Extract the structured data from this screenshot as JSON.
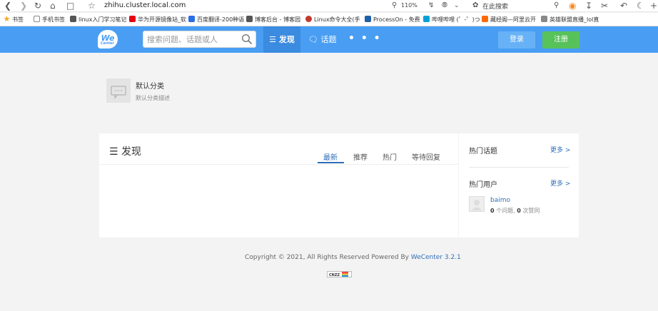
{
  "browser": {
    "url": "zhihu.cluster.local.com",
    "zoom": "110%",
    "search_placeholder": "在此搜索"
  },
  "bookmarks": [
    {
      "label": "书签",
      "color": "#f5a623"
    },
    {
      "label": "手机书签",
      "color": "#888888"
    },
    {
      "label": "linux入门学习笔记",
      "color": "#555555"
    },
    {
      "label": "华为开源镜像站_软",
      "color": "#e60012"
    },
    {
      "label": "百度翻译-200种语",
      "color": "#2b6de5"
    },
    {
      "label": "博客后台 - 博客园",
      "color": "#555555"
    },
    {
      "label": "Linux命令大全(手",
      "color": "#c0392b"
    },
    {
      "label": "ProcessOn - 免费",
      "color": "#1f5fa8"
    },
    {
      "label": "哔哩哔哩 (゜-゜)つ",
      "color": "#00a1d6"
    },
    {
      "label": "藏经阁—阿里云开",
      "color": "#ff6a00"
    },
    {
      "label": "英雄联盟直播_lol直",
      "color": "#888888"
    }
  ],
  "site": {
    "logo_text": "We",
    "logo_sub": "Center",
    "search_placeholder": "搜索问题、话题或人",
    "nav_discover": "☰ 发现",
    "nav_topics": "🗨 话题",
    "nav_more": "• • •",
    "login": "登录",
    "register": "注册"
  },
  "category": {
    "name": "默认分类",
    "description": "默认分类描述"
  },
  "discover": {
    "title": "☰ 发现",
    "tabs": [
      "最新",
      "推荐",
      "热门",
      "等待回复"
    ]
  },
  "sidebar": {
    "hot_topics": "热门话题",
    "hot_users": "热门用户",
    "more": "更多 >",
    "user": {
      "name": "baimo",
      "questions": "0",
      "questions_label": " 个问题, ",
      "likes": "0",
      "likes_label": " 次赞同"
    }
  },
  "footer": {
    "copyright": "Copyright © 2021, All Rights Reserved Powered By ",
    "powered_link": "WeCenter 3.2.1",
    "badge": "CNZZ"
  },
  "colors": {
    "header": "#499ef3",
    "nav_active": "#3b8be0",
    "login": "#67b2f7",
    "register": "#57c25a",
    "link": "#2e6fb9"
  }
}
